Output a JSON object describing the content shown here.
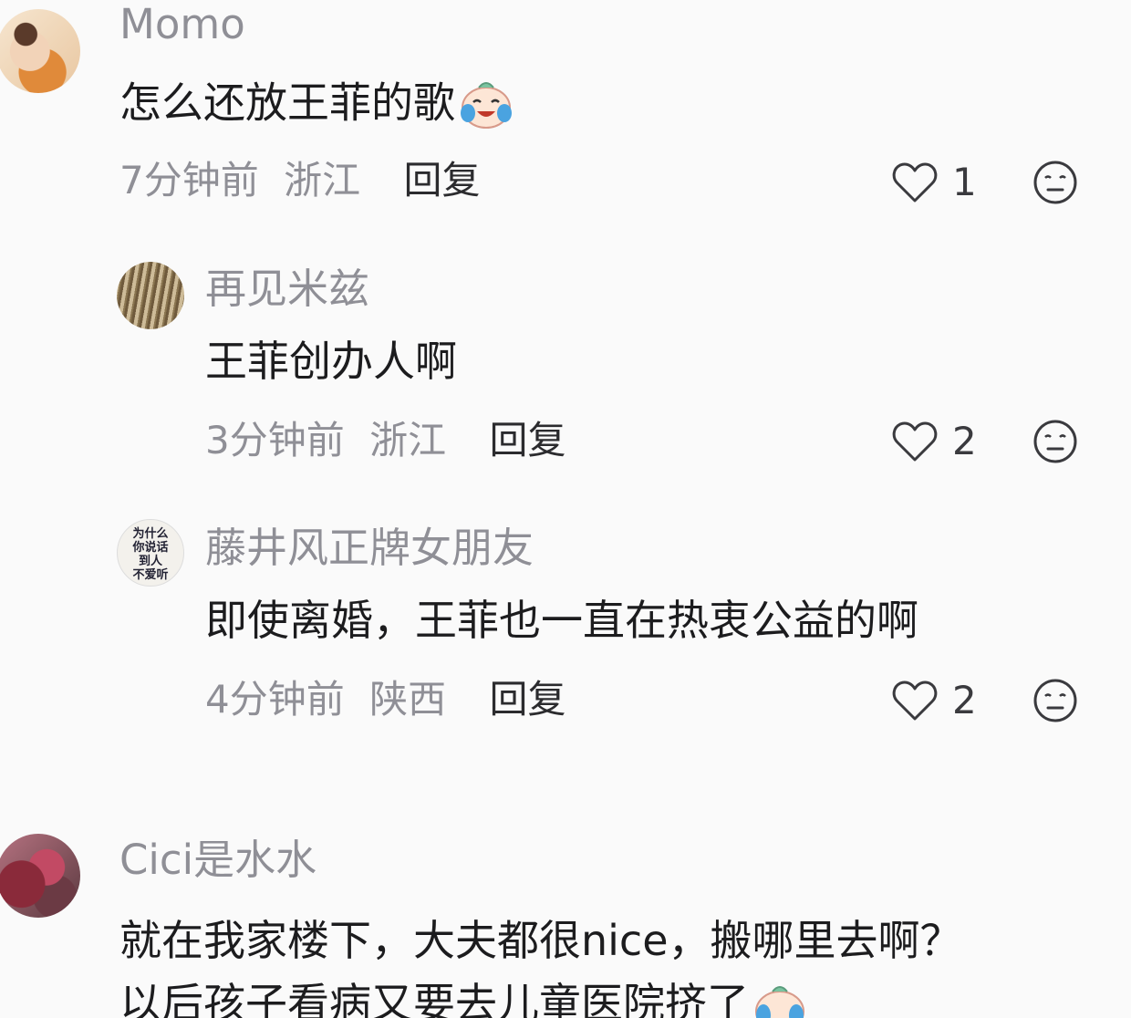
{
  "comments": [
    {
      "username": "Momo",
      "text": "怎么还放王菲的歌",
      "emoji": "crying-laughing-emoji",
      "time": "7分钟前",
      "location": "浙江",
      "reply_label": "回复",
      "likes": "1"
    },
    {
      "username": "再见米兹",
      "text": "王菲创办人啊",
      "time": "3分钟前",
      "location": "浙江",
      "reply_label": "回复",
      "likes": "2"
    },
    {
      "username": "藤井风正牌女朋友",
      "avatar_text": [
        "为什么",
        "你说话",
        "到人",
        "不爱听"
      ],
      "text": "即使离婚，王菲也一直在热衷公益的啊",
      "time": "4分钟前",
      "location": "陕西",
      "reply_label": "回复",
      "likes": "2"
    },
    {
      "username": "Cici是水水",
      "text_lines": [
        "就在我家楼下，大夫都很nice，搬哪里去啊？",
        "以后孩子看病又要去儿童医院挤了"
      ],
      "emoji": "crying-emoji"
    }
  ],
  "icons": {
    "like": "heart-outline-icon",
    "more": "neutral-face-icon"
  },
  "colors": {
    "background": "#fafafa",
    "username": "#8f8f96",
    "content": "#1c1c1e",
    "meta": "#8f8f96"
  }
}
